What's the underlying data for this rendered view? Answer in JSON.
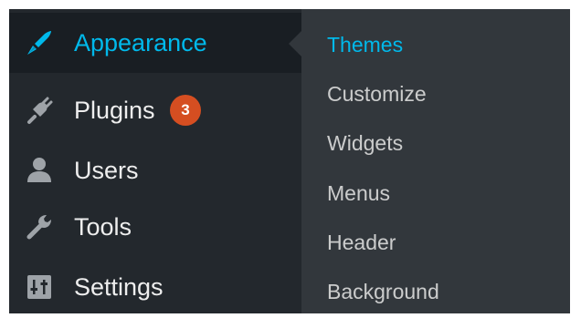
{
  "colors": {
    "menu_bg": "#23282d",
    "menu_current_bg": "#191e23",
    "submenu_bg": "#32373c",
    "accent": "#00b9eb",
    "badge": "#d54e21",
    "text": "#eeeeee"
  },
  "menu": {
    "items": [
      {
        "label": "Appearance",
        "icon": "paintbrush-icon",
        "current": true
      },
      {
        "label": "Plugins",
        "icon": "plug-icon",
        "badge": "3"
      },
      {
        "label": "Users",
        "icon": "users-icon"
      },
      {
        "label": "Tools",
        "icon": "wrench-icon"
      },
      {
        "label": "Settings",
        "icon": "settings-icon"
      }
    ]
  },
  "submenu": {
    "items": [
      {
        "label": "Themes",
        "current": true
      },
      {
        "label": "Customize"
      },
      {
        "label": "Widgets"
      },
      {
        "label": "Menus"
      },
      {
        "label": "Header"
      },
      {
        "label": "Background"
      }
    ]
  }
}
